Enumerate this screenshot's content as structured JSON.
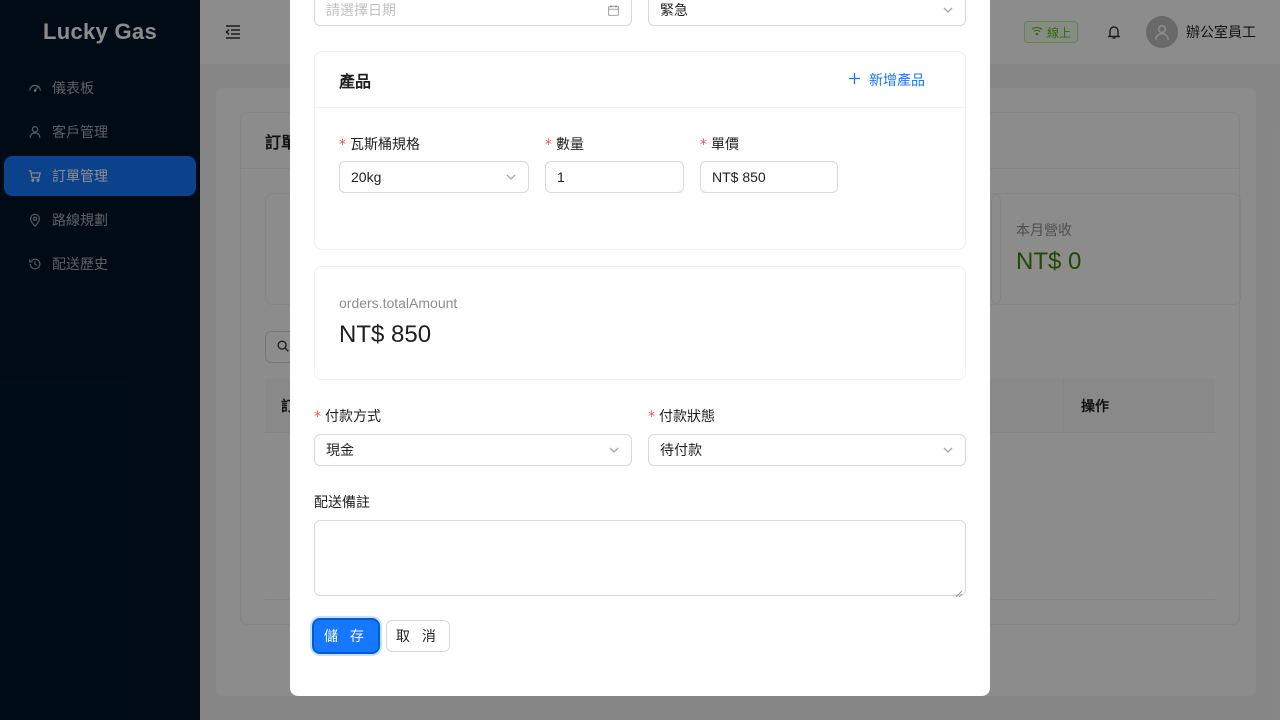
{
  "app": {
    "logo": "Lucky Gas"
  },
  "sidebar": {
    "items": [
      {
        "label": "儀表板",
        "icon": "dashboard-icon",
        "active": false
      },
      {
        "label": "客戶管理",
        "icon": "user-icon",
        "active": false
      },
      {
        "label": "訂單管理",
        "icon": "cart-icon",
        "active": true
      },
      {
        "label": "路線規劃",
        "icon": "location-icon",
        "active": false
      },
      {
        "label": "配送歷史",
        "icon": "history-icon",
        "active": false
      }
    ]
  },
  "header": {
    "status_label": "線上",
    "user_name": "辦公室員工"
  },
  "background": {
    "card_title": "訂單",
    "stat_label": "本月營收",
    "stat_value": "NT$ 0",
    "column_first": "訂",
    "column_actions": "操作"
  },
  "modal": {
    "date_placeholder": "請選擇日期",
    "priority_value": "緊急",
    "products": {
      "title": "產品",
      "add_label": "新增產品",
      "cylinder_label": "瓦斯桶規格",
      "cylinder_value": "20kg",
      "quantity_label": "數量",
      "quantity_value": "1",
      "price_label": "單價",
      "price_value": "NT$ 850"
    },
    "total": {
      "label": "orders.totalAmount",
      "value": "NT$ 850"
    },
    "payment_method_label": "付款方式",
    "payment_method_value": "現金",
    "payment_status_label": "付款狀態",
    "payment_status_value": "待付款",
    "notes_label": "配送備註",
    "notes_value": "",
    "save_label": "儲 存",
    "cancel_label": "取 消"
  },
  "colors": {
    "sidebar_bg": "#001529",
    "primary": "#1677ff",
    "success": "#52c41a",
    "stat_value": "#3f8600",
    "required": "#ff4d4f"
  }
}
